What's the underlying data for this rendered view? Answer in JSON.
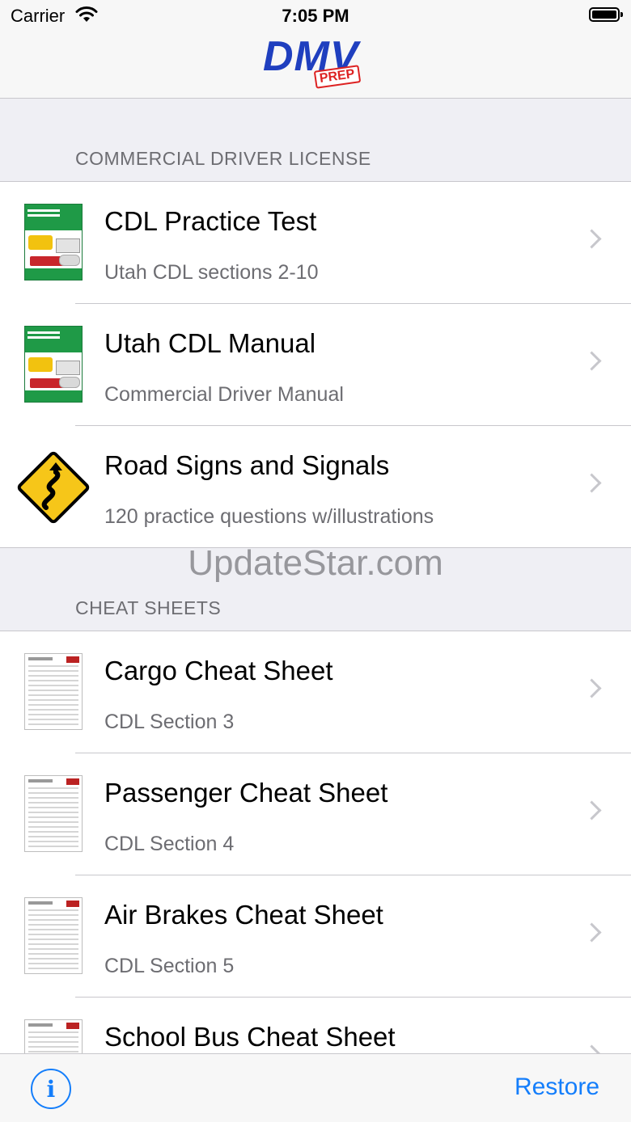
{
  "status_bar": {
    "carrier": "Carrier",
    "time": "7:05 PM"
  },
  "nav": {
    "logo_main": "DMV",
    "logo_sub": "PREP"
  },
  "sections": [
    {
      "header": "COMMERCIAL DRIVER LICENSE",
      "rows": [
        {
          "title": "CDL Practice Test",
          "subtitle": "Utah CDL sections 2-10",
          "icon": "cdl-manual-cover-icon"
        },
        {
          "title": "Utah CDL Manual",
          "subtitle": "Commercial Driver Manual",
          "icon": "cdl-manual-cover-icon"
        },
        {
          "title": "Road Signs and Signals",
          "subtitle": "120 practice questions w/illustrations",
          "icon": "winding-road-sign-icon"
        }
      ]
    },
    {
      "header": "CHEAT SHEETS",
      "rows": [
        {
          "title": "Cargo Cheat Sheet",
          "subtitle": "CDL Section 3",
          "icon": "cheat-sheet-document-icon"
        },
        {
          "title": "Passenger Cheat Sheet",
          "subtitle": "CDL Section 4",
          "icon": "cheat-sheet-document-icon"
        },
        {
          "title": "Air Brakes Cheat Sheet",
          "subtitle": "CDL Section 5",
          "icon": "cheat-sheet-document-icon"
        },
        {
          "title": "School Bus Cheat Sheet",
          "subtitle": "",
          "icon": "cheat-sheet-document-icon"
        }
      ]
    }
  ],
  "watermark": "UpdateStar.com",
  "toolbar": {
    "info_icon": "info-circle-icon",
    "restore_label": "Restore"
  },
  "colors": {
    "accent": "#147efb",
    "logo_blue": "#1f3fbf",
    "logo_red": "#dd2222",
    "cover_green": "#1f9a47",
    "sign_yellow": "#f6c619"
  }
}
